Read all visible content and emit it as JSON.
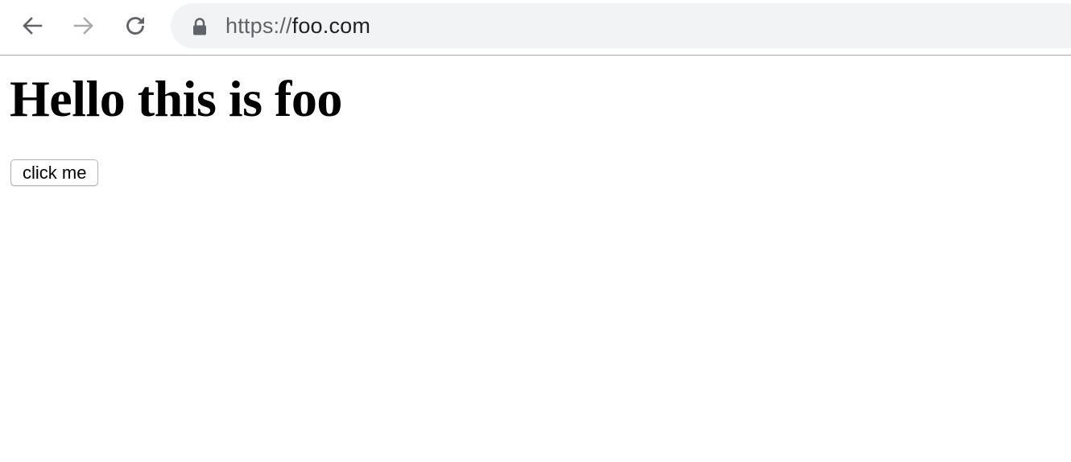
{
  "browser": {
    "back_icon": "arrow-left-icon",
    "forward_icon": "arrow-right-icon",
    "reload_icon": "reload-icon",
    "lock_icon": "lock-icon",
    "address_bar": {
      "scheme": "https://",
      "host": "foo.com"
    }
  },
  "page": {
    "heading": "Hello this is foo",
    "button_label": "click me"
  },
  "colors": {
    "omnibox_bg": "#f1f3f4",
    "icon_active": "#5f6368",
    "icon_disabled": "#a9abae",
    "url_text": "#202124"
  }
}
